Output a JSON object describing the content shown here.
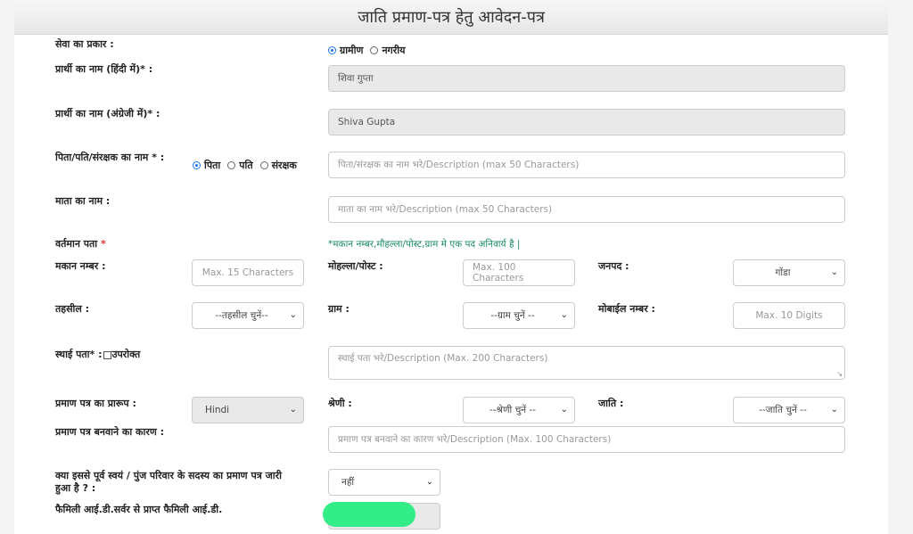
{
  "page": {
    "title": "जाति प्रमाण-पत्र हेतु आवेदन-पत्र"
  },
  "service_type": {
    "label": "सेवा का प्रकार :",
    "options": [
      "ग्रामीण",
      "नगरीय"
    ],
    "selected": "ग्रामीण"
  },
  "name_hindi": {
    "label": "प्रार्थी का नाम (हिंदी में)* :",
    "value": "शिवा गुप्ता"
  },
  "name_english": {
    "label": "प्रार्थी का नाम (अंग्रेजी में)* :",
    "value": "Shiva Gupta"
  },
  "guardian": {
    "label": "पिता/पति/संरक्षक का नाम * :",
    "options": [
      "पिता",
      "पति",
      "संरक्षक"
    ],
    "selected": "पिता",
    "placeholder": "पिता/संरक्षक का नाम भरे/Description (max 50 Characters)"
  },
  "mother": {
    "label": "माता का नाम :",
    "placeholder": "माता का नाम भरे/Description (max 50 Characters)"
  },
  "current_address": {
    "label": "वर्तमान पता",
    "star": "*",
    "note": "*मकान नम्बर,मौहल्ला/पोस्ट,ग्राम मे एक पद अनिवार्य है |"
  },
  "house_no": {
    "label": "मकान नम्बर :",
    "placeholder": "Max. 15 Characters"
  },
  "locality": {
    "label": "मोहल्ला/पोस्ट :",
    "placeholder": "Max. 100 Characters"
  },
  "district": {
    "label": "जनपद :",
    "value": "गोंडा"
  },
  "tehsil": {
    "label": "तहसील :",
    "value": "--तहसील चुनें--"
  },
  "village": {
    "label": "ग्राम :",
    "value": "--ग्राम चुनें --"
  },
  "mobile": {
    "label": "मोबाईल नम्बर :",
    "placeholder": "Max. 10 Digits"
  },
  "permanent_address": {
    "label": "स्थाई पता",
    "suffix": "* :",
    "checkbox_label": "उपरोक्त",
    "placeholder": "स्थाई पता भरे/Description (Max. 200 Characters)"
  },
  "certificate_format": {
    "label": "प्रमाण पत्र का प्रारूप :",
    "value": "Hindi"
  },
  "category": {
    "label": "श्रेणी :",
    "value": "--श्रेणी चुनें --"
  },
  "caste": {
    "label": "जाति :",
    "value": "--जाति चुनें --"
  },
  "reason": {
    "label": "प्रमाण पत्र बनवाने का कारण :",
    "placeholder": "प्रमाण पत्र बनवाने का कारण भरे/Description (Max. 100 Characters)"
  },
  "previous_issued": {
    "label": "क्या इससे पूर्व स्वयं / पुंज परिवार के सदस्य का प्रमाण पत्र जारी हुआ है ? :",
    "value": "नहीं"
  },
  "family_id": {
    "label": "फैमिली आई.डी.सर्वर से प्राप्त फैमिली आई.डी."
  },
  "colors": {
    "accent": "#1a73e8",
    "note": "#1a8a6a",
    "required": "#dd3333",
    "mask": "#33ee88"
  }
}
